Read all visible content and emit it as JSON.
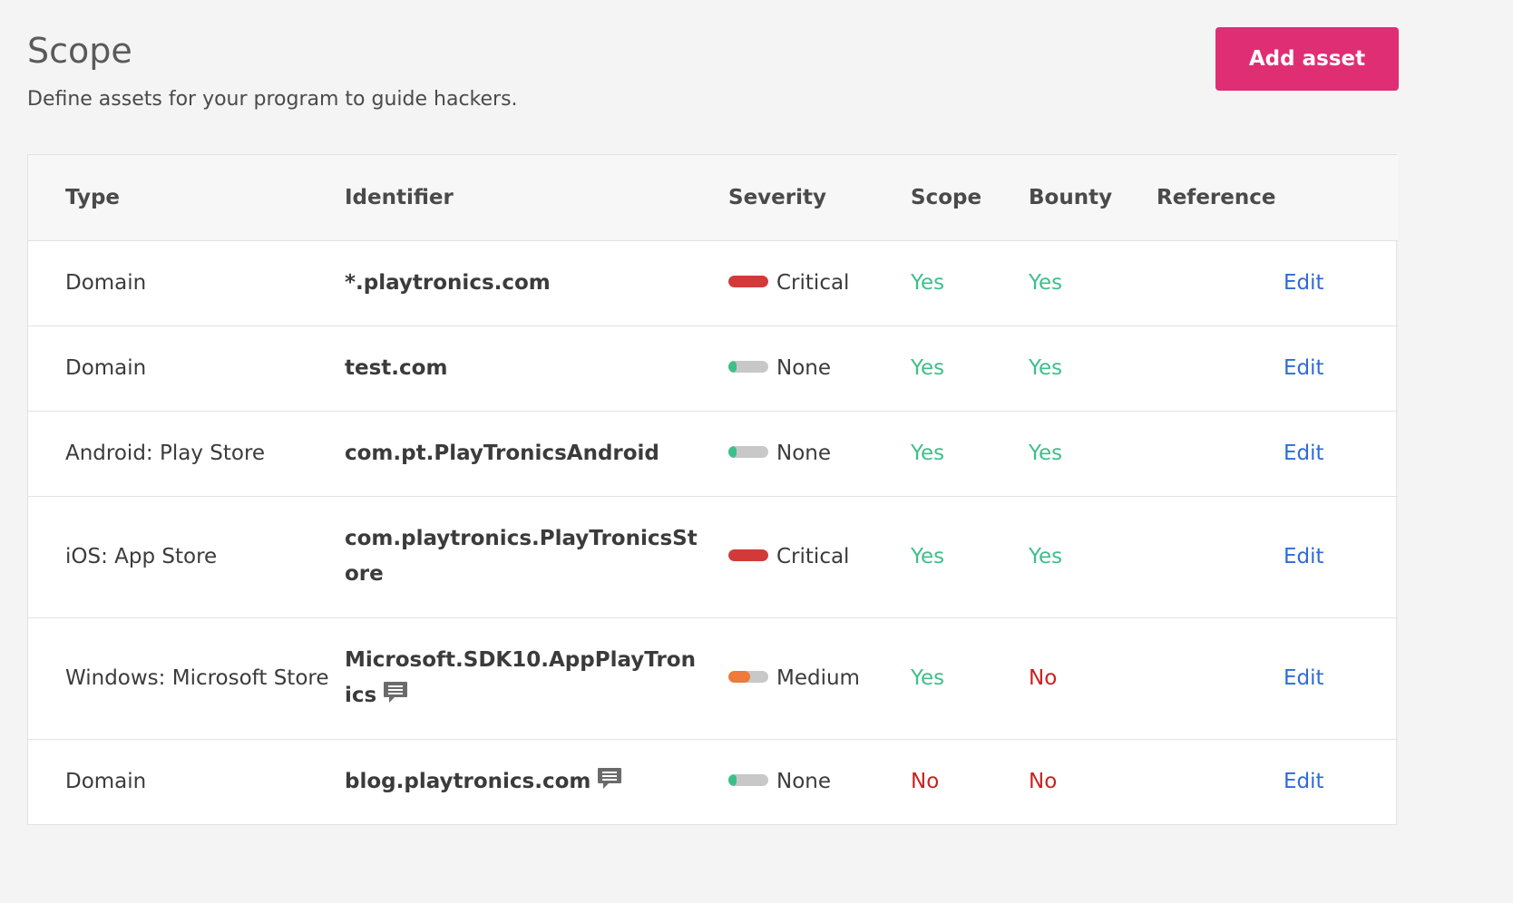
{
  "header": {
    "title": "Scope",
    "subtitle": "Define assets for your program to guide hackers.",
    "add_button": "Add asset"
  },
  "colors": {
    "accent": "#df2e74",
    "critical": "#d23a3a",
    "medium": "#ee7a3b",
    "none": "#3dbf8a",
    "yes": "#3dbf8a",
    "no": "#c9221f",
    "link": "#2f6bd8"
  },
  "table": {
    "columns": [
      "Type",
      "Identifier",
      "Severity",
      "Scope",
      "Bounty",
      "Reference"
    ],
    "rows": [
      {
        "type": "Domain",
        "identifier": "*.playtronics.com",
        "severity": "Critical",
        "severity_level": 1.0,
        "scope": "Yes",
        "bounty": "Yes",
        "reference": "",
        "action": "Edit",
        "has_comment": false
      },
      {
        "type": "Domain",
        "identifier": "test.com",
        "severity": "None",
        "severity_level": 0.2,
        "scope": "Yes",
        "bounty": "Yes",
        "reference": "",
        "action": "Edit",
        "has_comment": false
      },
      {
        "type": "Android: Play Store",
        "identifier": "com.pt.PlayTronicsAndroid",
        "severity": "None",
        "severity_level": 0.2,
        "scope": "Yes",
        "bounty": "Yes",
        "reference": "",
        "action": "Edit",
        "has_comment": false
      },
      {
        "type": "iOS: App Store",
        "identifier": "com.playtronics.PlayTronicsStore",
        "severity": "Critical",
        "severity_level": 1.0,
        "scope": "Yes",
        "bounty": "Yes",
        "reference": "",
        "action": "Edit",
        "has_comment": false
      },
      {
        "type": "Windows: Microsoft Store",
        "identifier": "Microsoft.SDK10.AppPlayTronics",
        "severity": "Medium",
        "severity_level": 0.55,
        "scope": "Yes",
        "bounty": "No",
        "reference": "",
        "action": "Edit",
        "has_comment": true
      },
      {
        "type": "Domain",
        "identifier": "blog.playtronics.com",
        "severity": "None",
        "severity_level": 0.2,
        "scope": "No",
        "bounty": "No",
        "reference": "",
        "action": "Edit",
        "has_comment": true
      }
    ]
  }
}
